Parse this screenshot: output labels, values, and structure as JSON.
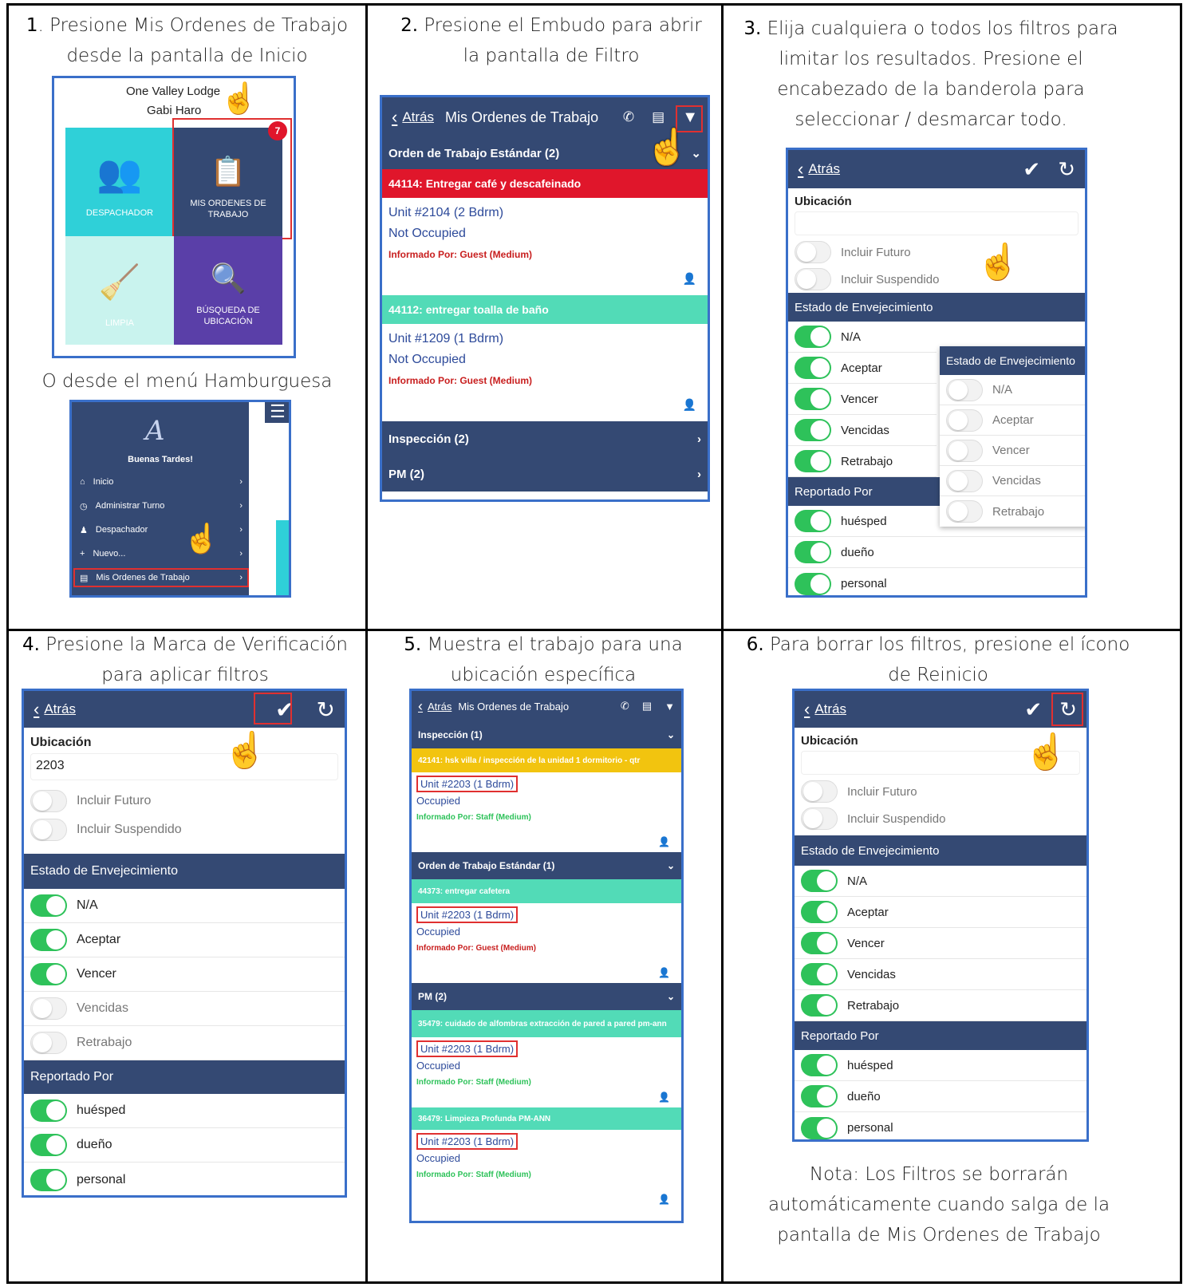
{
  "steps": [
    {
      "num": "1",
      "text": ". Presione Mis Ordenes de Trabajo desde la pantalla de Inicio"
    },
    {
      "num": "2.",
      "text": " Presione el Embudo para abrir la pantalla de Filtro"
    },
    {
      "num": "3.",
      "text": " Elija cualquiera o todos los filtros para limitar los resultados. Presione el encabezado de la banderola para seleccionar / desmarcar todo."
    },
    {
      "num": "4.",
      "text": " Presione la Marca de Verificación para aplicar filtros"
    },
    {
      "num": "5.",
      "text": " Muestra el trabajo para una ubicación específica"
    },
    {
      "num": "6.",
      "text": " Para borrar los filtros, presione el ícono de Reinicio"
    }
  ],
  "or_text": "O desde el menú Hamburguesa",
  "note": "Nota: Los Filtros se borrarán automáticamente cuando salga de la pantalla de Mis Ordenes de Trabajo",
  "home": {
    "property": "One Valley Lodge",
    "user": "Gabi Haro",
    "badge": "7",
    "tiles": [
      "DESPACHADOR",
      "MIS ORDENES DE TRABAJO",
      "LIMPIA",
      "BÚSQUEDA DE UBICACIÓN"
    ],
    "colors": {
      "teal": "#2fd0d8",
      "navy": "#344973",
      "pale": "#c9f3ee",
      "purple": "#5a3fa8"
    }
  },
  "menu": {
    "greeting": "Buenas Tardes!",
    "items": [
      "Inicio",
      "Administrar Turno",
      "Despachador",
      "Nuevo...",
      "Mis Ordenes de Trabajo"
    ]
  },
  "common": {
    "back": "Atrás",
    "list_title": "Mis Ordenes de Trabajo",
    "ubicacion": "Ubicación",
    "incluir_futuro": "Incluir Futuro",
    "incluir_suspendido": "Incluir Suspendido",
    "estado": "Estado de Envejecimiento",
    "reportado": "Reportado Por",
    "aging": [
      "N/A",
      "Aceptar",
      "Vencer",
      "Vencidas",
      "Retrabajo"
    ],
    "reporters": [
      "huésped",
      "dueño",
      "personal"
    ]
  },
  "list2": {
    "groups": [
      "Orden de Trabajo Estándar (2)",
      "Inspección (2)",
      "PM (2)"
    ],
    "orders": [
      {
        "head": "44114: Entregar café y descafeinado",
        "unit": "Unit #2104 (2 Bdrm)",
        "status": "Not Occupied",
        "rep": "Informado Por: Guest  (Medium)",
        "color": "#e0162b"
      },
      {
        "head": "44112: entregar toalla de baño",
        "unit": "Unit #1209 (1 Bdrm)",
        "status": "Not Occupied",
        "rep": "Informado Por: Guest  (Medium)",
        "color": "#52dbb7"
      }
    ]
  },
  "filter4": {
    "location_value": "2203",
    "aging_on": [
      true,
      true,
      true,
      false,
      false
    ]
  },
  "list5": {
    "groups": [
      "Inspección (1)",
      "Orden de Trabajo Estándar (1)",
      "PM (2)"
    ],
    "orders": [
      {
        "head": "42141: hsk villa / inspección de la unidad 1 dormitorio - qtr",
        "unit": "Unit #2203 (1 Bdrm)",
        "status": "Occupied",
        "rep": "Informado Por: Staff  (Medium)",
        "color": "#f2c40f"
      },
      {
        "head": "44373: entregar cafetera",
        "unit": "Unit #2203 (1 Bdrm)",
        "status": "Occupied",
        "rep": "Informado Por: Guest  (Medium)",
        "color": "#52dbb7"
      },
      {
        "head": "35479: cuidado de alfombras extracción de pared a pared pm-ann",
        "unit": "Unit #2203 (1 Bdrm)",
        "status": "Occupied",
        "rep": "Informado Por: Staff  (Medium)",
        "color": "#52dbb7"
      },
      {
        "head": "36479: Limpieza Profunda PM-ANN",
        "unit": "Unit #2203 (1 Bdrm)",
        "status": "Occupied",
        "rep": "Informado Por: Staff  (Medium)",
        "color": "#52dbb7"
      }
    ]
  }
}
